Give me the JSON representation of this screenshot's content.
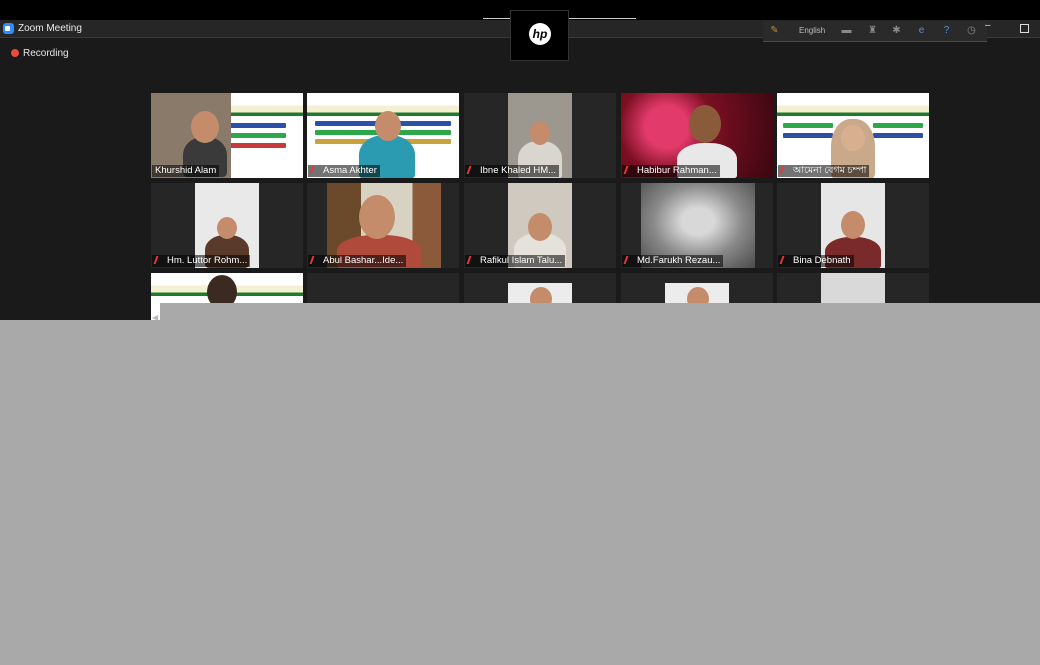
{
  "window": {
    "title": "Zoom Meeting"
  },
  "toolbar": {
    "language": "English"
  },
  "status": {
    "recording_label": "Recording"
  },
  "camera_brand": "hp",
  "participants": [
    {
      "name": "Khurshid Alam",
      "muted": false
    },
    {
      "name": "Asma Akhter",
      "muted": true
    },
    {
      "name": "Ibne Khaled HM...",
      "muted": true
    },
    {
      "name": "Habibur Rahman...",
      "muted": true
    },
    {
      "name": "আমেনা বেগম চম্পা",
      "muted": true
    },
    {
      "name": "Hm. Luttor Rohm...",
      "muted": true
    },
    {
      "name": "Abul Bashar...Ide...",
      "muted": true
    },
    {
      "name": "Rafikul Islam Talu...",
      "muted": true
    },
    {
      "name": "Md.Farukh Rezau...",
      "muted": true
    },
    {
      "name": "Bina Debnath",
      "muted": true
    }
  ]
}
